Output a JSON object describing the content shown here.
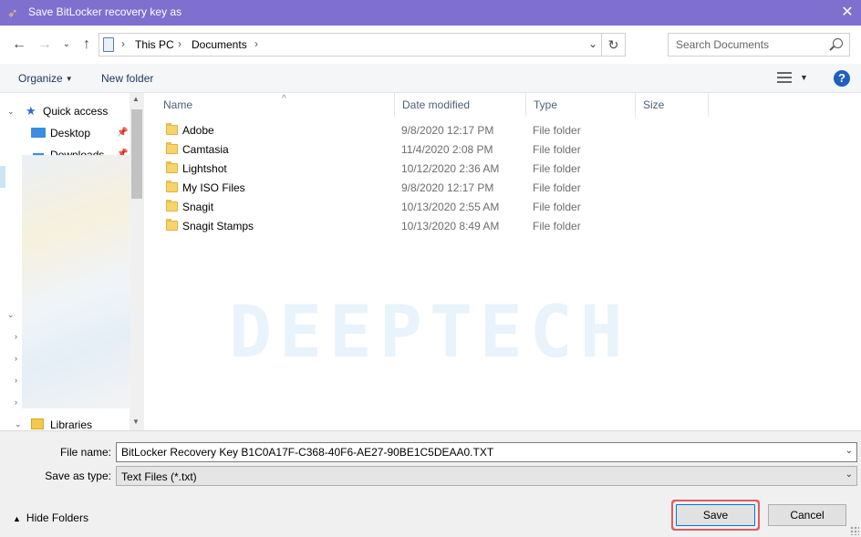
{
  "window": {
    "title": "Save BitLocker recovery key as",
    "close_glyph": "✕"
  },
  "navigation": {
    "back_glyph": "←",
    "forward_glyph": "→",
    "recent_glyph": "⌄",
    "up_glyph": "↑",
    "breadcrumb": [
      "This PC",
      "Documents"
    ],
    "refresh_glyph": "↻",
    "search_placeholder": "Search Documents"
  },
  "toolbar": {
    "organize_label": "Organize",
    "new_folder_label": "New folder",
    "help_label": "?"
  },
  "sidebar": {
    "quick_access_label": "Quick access",
    "items": [
      {
        "label": "Desktop",
        "icon": "desktop-icon",
        "pinned": true
      },
      {
        "label": "Downloads",
        "icon": "downloads-icon",
        "pinned": true
      }
    ],
    "libraries_label": "Libraries"
  },
  "file_list": {
    "columns": [
      "Name",
      "Date modified",
      "Type",
      "Size"
    ],
    "sort_column": "Name",
    "rows": [
      {
        "name": "Adobe",
        "date": "9/8/2020 12:17 PM",
        "type": "File folder"
      },
      {
        "name": "Camtasia",
        "date": "11/4/2020 2:08 PM",
        "type": "File folder"
      },
      {
        "name": "Lightshot",
        "date": "10/12/2020 2:36 AM",
        "type": "File folder"
      },
      {
        "name": "My ISO Files",
        "date": "9/8/2020 12:17 PM",
        "type": "File folder"
      },
      {
        "name": "Snagit",
        "date": "10/13/2020 2:55 AM",
        "type": "File folder"
      },
      {
        "name": "Snagit Stamps",
        "date": "10/13/2020 8:49 AM",
        "type": "File folder"
      }
    ],
    "watermark": "DEEPTECH"
  },
  "save_form": {
    "file_name_label": "File name:",
    "file_name_value": "BitLocker Recovery Key B1C0A17F-C368-40F6-AE27-90BE1C5DEAA0.TXT",
    "save_type_label": "Save as type:",
    "save_type_value": "Text Files (*.txt)",
    "hide_folders_label": "Hide Folders",
    "save_button": "Save",
    "cancel_button": "Cancel"
  },
  "colors": {
    "titlebar": "#7f6fcf",
    "save_highlight": "#e05b63",
    "accent": "#0078d7"
  }
}
